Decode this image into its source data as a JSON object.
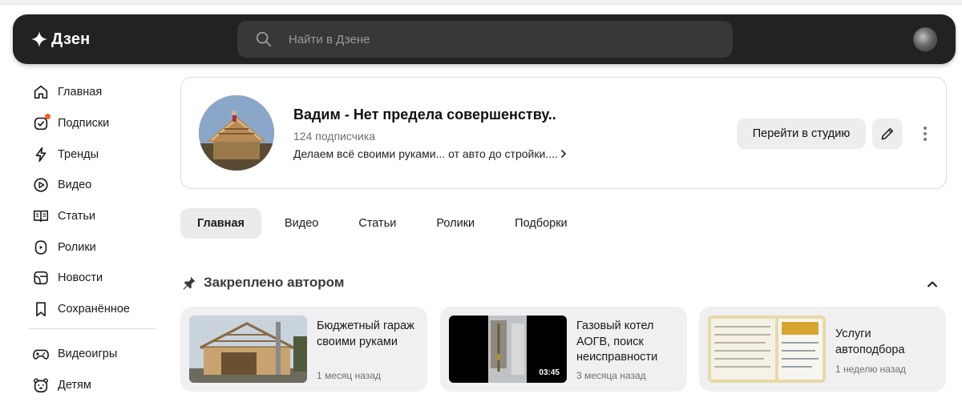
{
  "app": {
    "logo_text": "Дзен"
  },
  "search": {
    "placeholder": "Найти в Дзене"
  },
  "sidebar": {
    "items": [
      {
        "label": "Главная",
        "icon": "home-icon"
      },
      {
        "label": "Подписки",
        "icon": "subscriptions-icon",
        "has_notification_dot": true
      },
      {
        "label": "Тренды",
        "icon": "lightning-icon"
      },
      {
        "label": "Видео",
        "icon": "video-play-icon"
      },
      {
        "label": "Статьи",
        "icon": "book-icon"
      },
      {
        "label": "Ролики",
        "icon": "shorts-icon"
      },
      {
        "label": "Новости",
        "icon": "news-icon"
      },
      {
        "label": "Сохранённое",
        "icon": "bookmark-icon"
      }
    ],
    "extra_items": [
      {
        "label": "Видеоигры",
        "icon": "gamepad-icon"
      },
      {
        "label": "Детям",
        "icon": "bear-icon"
      }
    ]
  },
  "channel": {
    "name": "Вадим - Нет предела совершенству..",
    "subscribers": "124 подписчика",
    "description": "Делаем всё своими руками... от авто до стройки....",
    "studio_button": "Перейти в студию"
  },
  "tabs": [
    {
      "label": "Главная",
      "active": true
    },
    {
      "label": "Видео",
      "active": false
    },
    {
      "label": "Статьи",
      "active": false
    },
    {
      "label": "Ролики",
      "active": false
    },
    {
      "label": "Подборки",
      "active": false
    }
  ],
  "pinned": {
    "title": "Закреплено автором",
    "cards": [
      {
        "title": "Бюджетный гараж своими руками",
        "date": "1 месяц назад",
        "duration": ""
      },
      {
        "title": "Газовый котел АОГВ, поиск неисправности",
        "date": "3 месяца назад",
        "duration": "03:45"
      },
      {
        "title": "Услуги автоподбора",
        "date": "1 неделю назад",
        "duration": ""
      }
    ]
  },
  "colors": {
    "header_bg": "#222224",
    "notification_dot": "#ff5a1f",
    "active_tab_bg": "#ebebed",
    "card_bg": "#f0f0f2"
  }
}
